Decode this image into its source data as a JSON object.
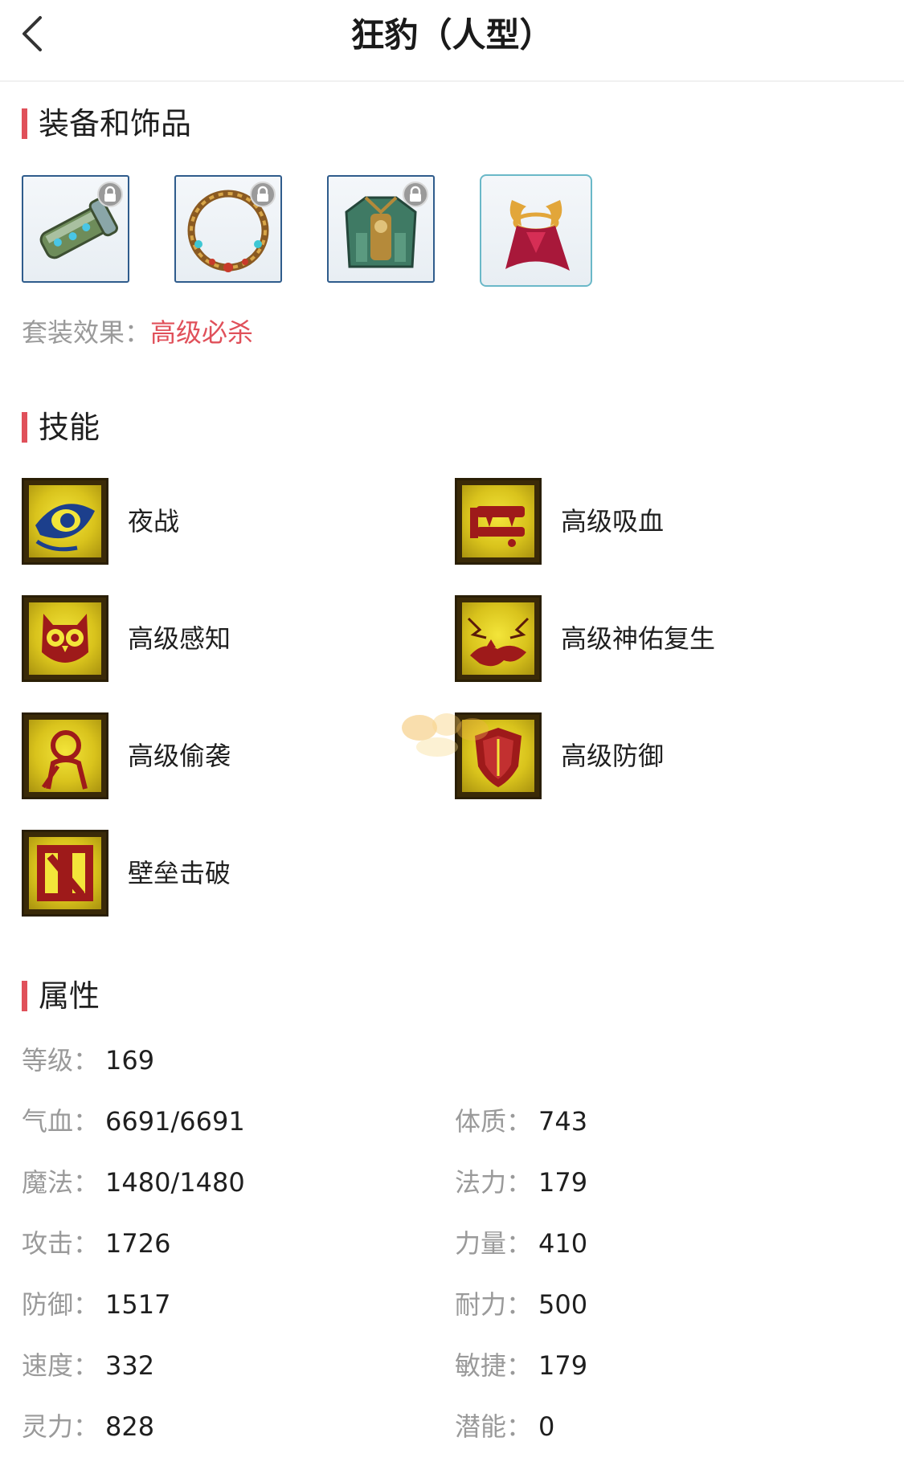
{
  "header": {
    "title": "狂豹（人型）",
    "back_icon": "chevron-left-icon"
  },
  "equipment": {
    "section_title": "装备和饰品",
    "items": [
      {
        "name": "gauntlet-icon",
        "locked": true
      },
      {
        "name": "necklace-icon",
        "locked": true
      },
      {
        "name": "armor-icon",
        "locked": true
      },
      {
        "name": "horned-cape-icon",
        "locked": false
      }
    ],
    "set_effect_label": "套装效果：",
    "set_effect_value": "高级必杀"
  },
  "skills": {
    "section_title": "技能",
    "items": [
      {
        "name": "夜战",
        "icon": "eye-icon"
      },
      {
        "name": "高级吸血",
        "icon": "fang-icon"
      },
      {
        "name": "高级感知",
        "icon": "owl-icon"
      },
      {
        "name": "高级神佑复生",
        "icon": "wings-icon"
      },
      {
        "name": "高级偷袭",
        "icon": "assassin-icon"
      },
      {
        "name": "高级防御",
        "icon": "shield-icon"
      },
      {
        "name": "壁垒击破",
        "icon": "broken-wall-icon"
      }
    ]
  },
  "attributes": {
    "section_title": "属性",
    "level": {
      "label": "等级：",
      "value": "169"
    },
    "left": [
      {
        "label": "气血：",
        "value": "6691/6691"
      },
      {
        "label": "魔法：",
        "value": "1480/1480"
      },
      {
        "label": "攻击：",
        "value": "1726"
      },
      {
        "label": "防御：",
        "value": "1517"
      },
      {
        "label": "速度：",
        "value": "332"
      },
      {
        "label": "灵力：",
        "value": "828"
      }
    ],
    "right": [
      {
        "label": "体质：",
        "value": "743"
      },
      {
        "label": "法力：",
        "value": "179"
      },
      {
        "label": "力量：",
        "value": "410"
      },
      {
        "label": "耐力：",
        "value": "500"
      },
      {
        "label": "敏捷：",
        "value": "179"
      },
      {
        "label": "潜能：",
        "value": "0"
      }
    ]
  },
  "colors": {
    "accent": "#e0505a",
    "label_gray": "#9a9a9a",
    "equip_border": "#2f5c8c",
    "accessory_border": "#6ab8c8"
  }
}
